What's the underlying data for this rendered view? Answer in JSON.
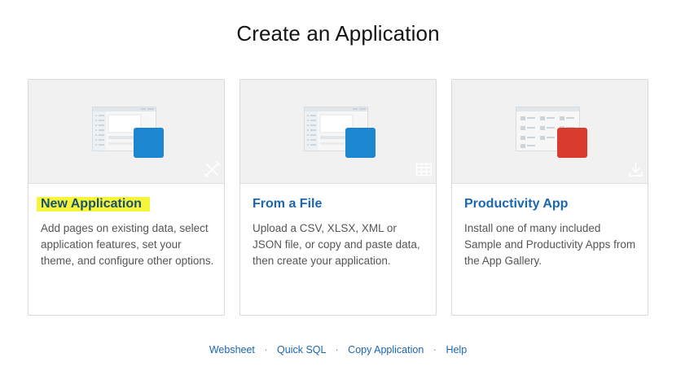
{
  "page": {
    "title": "Create an Application"
  },
  "cards": [
    {
      "title": "New Application",
      "description": "Add pages on existing data, select application features, set your theme, and configure other options.",
      "icon": "wand-icon",
      "badge_color": "#1d86d0"
    },
    {
      "title": "From a File",
      "description": "Upload a CSV, XLSX, XML or JSON file, or copy and paste data, then create your application.",
      "icon": "table-icon",
      "badge_color": "#1d86d0"
    },
    {
      "title": "Productivity App",
      "description": "Install one of many included Sample and Productivity Apps from the App Gallery.",
      "icon": "download-icon",
      "badge_color": "#d93b2f"
    }
  ],
  "footer": {
    "links": [
      "Websheet",
      "Quick SQL",
      "Copy Application",
      "Help"
    ],
    "separator": "·"
  },
  "colors": {
    "link": "#1a66b3",
    "highlight": "#f5f53a"
  }
}
